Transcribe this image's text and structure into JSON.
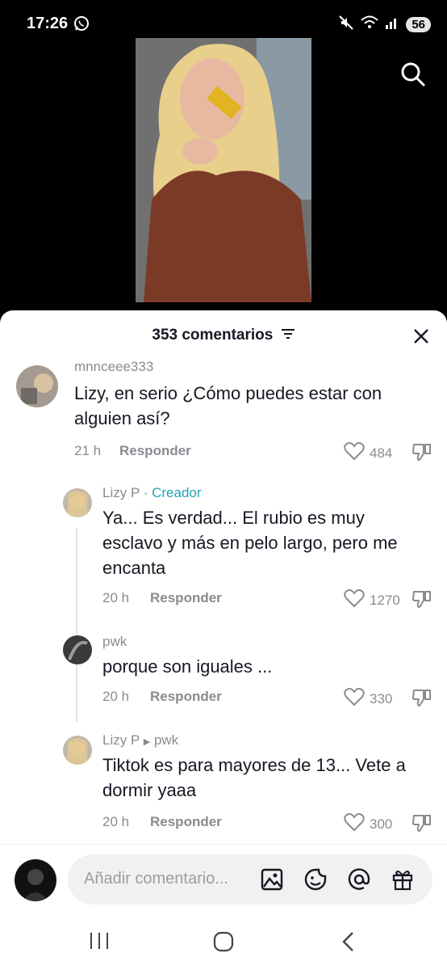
{
  "status": {
    "time": "17:26",
    "battery": "56"
  },
  "sheet": {
    "title": "353 comentarios"
  },
  "comments": [
    {
      "username": "mnnceee333",
      "text": "Lizy, en serio ¿Cómo puedes estar con alguien así?",
      "time": "21 h",
      "reply": "Responder",
      "likes": "484"
    },
    {
      "username": "Lizy P",
      "tag": "· Creador",
      "text": "Ya... Es verdad... El rubio es muy esclavo y más en pelo largo, pero me encanta",
      "time": "20 h",
      "reply": "Responder",
      "likes": "1270"
    },
    {
      "username": "pwk",
      "text": "porque son iguales ...",
      "time": "20 h",
      "reply": "Responder",
      "likes": "330"
    },
    {
      "username": "Lizy P",
      "reply_to": "pwk",
      "text": "Tiktok es para mayores de 13... Vete a dormir yaaa",
      "time": "20 h",
      "reply": "Responder",
      "likes": "300"
    }
  ],
  "composer": {
    "placeholder": "Añadir comentario..."
  },
  "icons": [
    "whatsapp-icon",
    "mute-icon",
    "wifi-icon",
    "signal-icon",
    "search-icon",
    "filter-icon",
    "close-icon",
    "heart-icon",
    "dislike-icon",
    "image-icon",
    "emoji-icon",
    "mention-icon",
    "gift-icon",
    "recents-icon",
    "home-icon",
    "back-icon"
  ]
}
